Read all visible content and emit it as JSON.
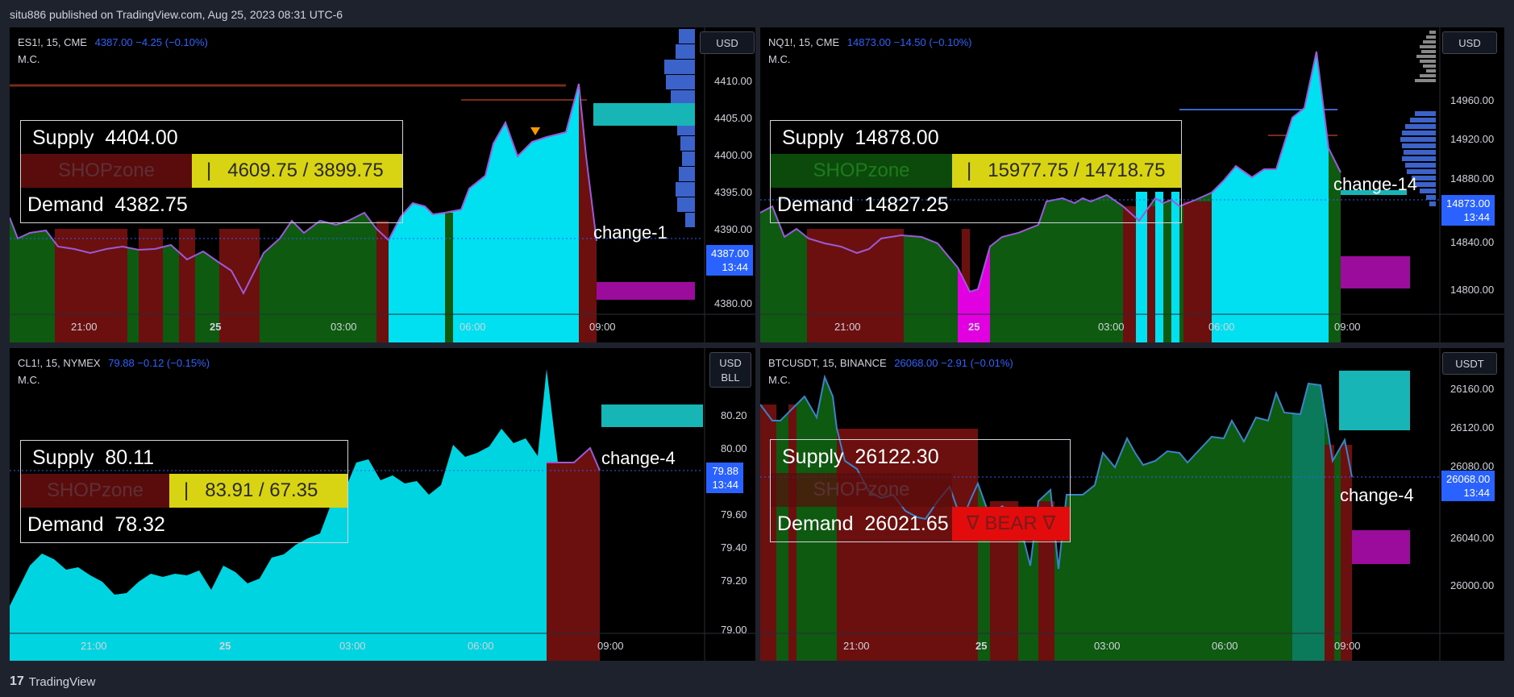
{
  "topline": "situ886 published on TradingView.com, Aug 25, 2023 08:31 UTC-6",
  "footer": {
    "brand": "TradingView"
  },
  "colors": {
    "bg": "#1e222d",
    "chart_bg": "#000000",
    "price_blue": "#2962ff",
    "cyan": "#00e5ff",
    "green": "#0f6b12",
    "maroon": "#6b0f0f",
    "magenta": "#e000e0",
    "yellow_box": "#d9d413"
  },
  "panels": [
    {
      "id": "es",
      "symbol": "ES1!, 15, CME",
      "price": "4387.00",
      "change": "−4.25 (−0.10%)",
      "indicator": "M.C.",
      "currency": "USD",
      "price_tag": {
        "price": "4387.00",
        "time": "13:44"
      },
      "y_ticks": [
        "4410.00",
        "4405.00",
        "4400.00",
        "4395.00",
        "4390.00",
        "4380.00"
      ],
      "x_ticks": [
        "21:00",
        "25",
        "03:00",
        "06:00",
        "09:00"
      ],
      "supply": "Supply  4404.00",
      "shop": "SHOPzone",
      "range": "|   4609.75 / 3899.75",
      "demand": "Demand  4382.75",
      "change_label": "change-1"
    },
    {
      "id": "nq",
      "symbol": "NQ1!, 15, CME",
      "price": "14873.00",
      "change": "−14.50 (−0.10%)",
      "indicator": "M.C.",
      "currency": "USD",
      "price_tag": {
        "price": "14873.00",
        "time": "13:44"
      },
      "y_ticks": [
        "14960.00",
        "14920.00",
        "14880.00",
        "14840.00",
        "14800.00"
      ],
      "x_ticks": [
        "21:00",
        "25",
        "03:00",
        "06:00",
        "09:00"
      ],
      "supply": "Supply  14878.00",
      "shop": "SHOPzone",
      "range": "|   15977.75 / 14718.75",
      "demand": "Demand  14827.25",
      "change_label": "change-14"
    },
    {
      "id": "cl",
      "symbol": "CL1!, 15, NYMEX",
      "price": "79.88",
      "change": "−0.12 (−0.15%)",
      "indicator": "M.C.",
      "currency": "USD",
      "currency2": "BLL",
      "price_tag": {
        "price": "79.88",
        "time": "13:44"
      },
      "y_ticks": [
        "80.20",
        "80.00",
        "79.60",
        "79.40",
        "79.20",
        "79.00"
      ],
      "x_ticks": [
        "21:00",
        "25",
        "03:00",
        "06:00",
        "09:00"
      ],
      "supply": "Supply  80.11",
      "shop": "SHOPzone",
      "range": "|   83.91 / 67.35",
      "demand": "Demand  78.32",
      "change_label": "change-4"
    },
    {
      "id": "btc",
      "symbol": "BTCUSDT, 15, BINANCE",
      "price": "26068.00",
      "change": "−2.91 (−0.01%)",
      "indicator": "M.C.",
      "currency": "USDT",
      "price_tag": {
        "price": "26068.00",
        "time": "13:44"
      },
      "y_ticks": [
        "26160.00",
        "26120.00",
        "26080.00",
        "26040.00",
        "26000.00"
      ],
      "x_ticks": [
        "21:00",
        "25",
        "03:00",
        "06:00",
        "09:00"
      ],
      "supply": "Supply  26122.30",
      "shop": "SHOPzone",
      "demand": "Demand  26021.65",
      "bear": "∇ BEAR ∇",
      "change_label": "change-4"
    }
  ]
}
